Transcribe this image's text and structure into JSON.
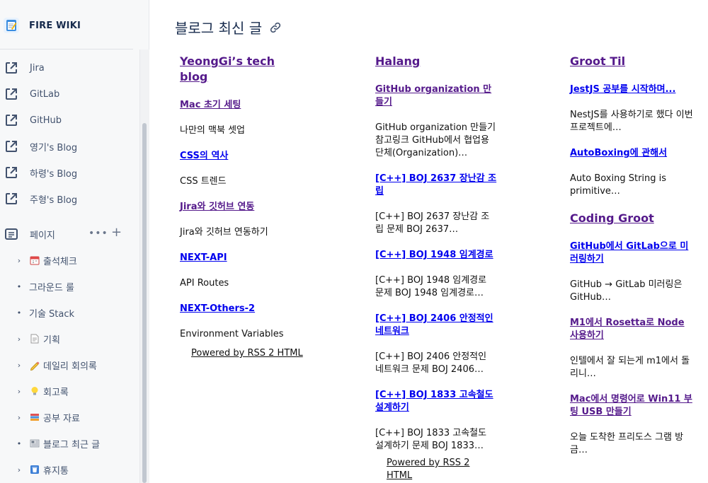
{
  "sidebar": {
    "space_title": "FIRE WIKI",
    "links": [
      {
        "label": "Jira"
      },
      {
        "label": "GitLab"
      },
      {
        "label": "GitHub"
      },
      {
        "label": "영기's Blog"
      },
      {
        "label": "하령's Blog"
      },
      {
        "label": "주형's Blog"
      }
    ],
    "pages_label": "페이지",
    "pages_more": "•••",
    "pages_add": "+",
    "tree": [
      {
        "label": "출석체크",
        "marker": "›",
        "icon": "calendar-icon"
      },
      {
        "label": "그라운드 룰",
        "marker": "•",
        "icon": ""
      },
      {
        "label": "기술 Stack",
        "marker": "•",
        "icon": ""
      },
      {
        "label": "기획",
        "marker": "›",
        "icon": "page-icon"
      },
      {
        "label": "데일리 회의록",
        "marker": "›",
        "icon": "pencil-icon"
      },
      {
        "label": "회고록",
        "marker": "›",
        "icon": "lightbulb-icon"
      },
      {
        "label": "공부 자료",
        "marker": "›",
        "icon": "books-icon"
      },
      {
        "label": "블로그 최근 글",
        "marker": "•",
        "icon": "newspaper-icon"
      },
      {
        "label": "휴지통",
        "marker": "›",
        "icon": "trash-icon"
      }
    ]
  },
  "main": {
    "title": "블로그 최신 글",
    "columns": [
      {
        "blog": "YeongGi’s tech blog",
        "posts": [
          {
            "title": "Mac 초기 세팅",
            "desc": "나만의 맥북 셋업",
            "visited": true
          },
          {
            "title": "CSS의 역사",
            "desc": "CSS 트렌드",
            "visited": false
          },
          {
            "title": "Jira와 깃허브 연동",
            "desc": "Jira와 깃허브 연동하기",
            "visited": true
          },
          {
            "title": "NEXT-API",
            "desc": "API Routes",
            "visited": false
          },
          {
            "title": "NEXT-Others-2",
            "desc": "Environment Variables",
            "visited": false
          }
        ],
        "powered": "Powered by RSS 2 HTML"
      },
      {
        "blog": "Halang",
        "posts": [
          {
            "title": "GitHub organization 만들기",
            "desc": "GitHub organization 만들기 참고링크 GitHub에서 협업용 단체(Organization)…",
            "visited": true
          },
          {
            "title": "[C++] BOJ 2637 장난감 조립",
            "desc": "[C++] BOJ 2637 장난감 조립 문제 BOJ 2637…",
            "visited": false
          },
          {
            "title": "[C++] BOJ 1948 임계경로",
            "desc": "[C++] BOJ 1948 임계경로 문제 BOJ 1948 임계경로…",
            "visited": false
          },
          {
            "title": "[C++] BOJ 2406 안정적인 네트워크",
            "desc": "[C++] BOJ 2406 안정적인 네트워크 문제 BOJ 2406…",
            "visited": false
          },
          {
            "title": "[C++] BOJ 1833 고속철도 설계하기",
            "desc": "[C++] BOJ 1833 고속철도 설계하기 문제 BOJ 1833…",
            "visited": false
          }
        ],
        "powered": "Powered by RSS 2 HTML"
      },
      {
        "blog": "Groot Til",
        "posts": [
          {
            "title": "JestJS 공부를 시작하며...",
            "desc": "NestJS를 사용하기로 했다 이번 프로젝트에…",
            "visited": false
          },
          {
            "title": "AutoBoxing에 관해서",
            "desc": "Auto Boxing String is primitive…",
            "visited": false
          }
        ],
        "blog2": "Coding Groot",
        "posts2": [
          {
            "title": "GitHub에서 GitLab으로 미러링하기",
            "desc": "GitHub → GitLab 미러링은 GitHub…",
            "visited": false
          },
          {
            "title": "M1에서 Rosetta로 Node 사용하기",
            "desc": "인텔에서 잘 되는게 m1에서 돌리니…",
            "visited": true
          },
          {
            "title": "Mac에서 명령어로 Win11 부팅 USB 만들기",
            "desc": "오늘 도착한 프리도스 그램 방금…",
            "visited": true
          }
        ]
      }
    ]
  },
  "colors": {
    "visited_link": "#551a8b",
    "unvisited_link": "#0000ee",
    "sidebar_bg": "#f7f8f9"
  }
}
